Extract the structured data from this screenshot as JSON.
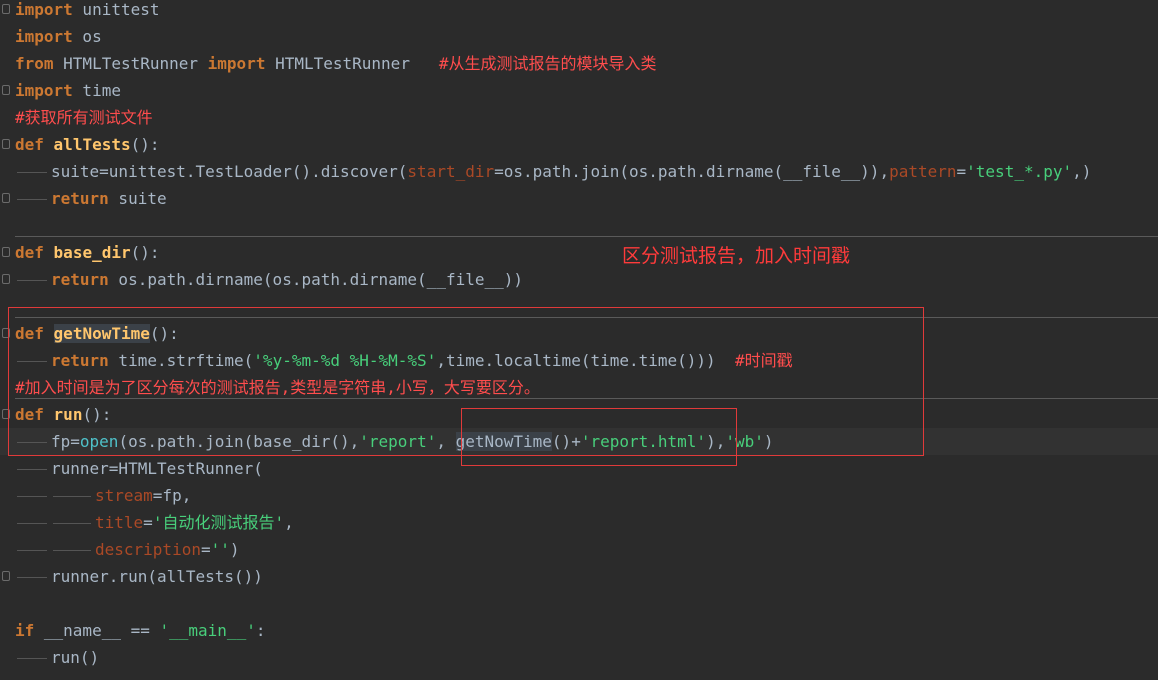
{
  "annotation": "区分测试报告，加入时间戳",
  "code": {
    "l1": [
      "import",
      " unittest"
    ],
    "l2": [
      "import",
      " os"
    ],
    "l3": [
      "from",
      " HTMLTestRunner ",
      "import",
      " HTMLTestRunner   ",
      "#从生成测试报告的模块导入类"
    ],
    "l4": [
      "import",
      " time"
    ],
    "l5": [
      "#获取所有测试文件"
    ],
    "l6": [
      "def",
      " ",
      "allTests",
      "():"
    ],
    "l7": [
      "suite=unittest.TestLoader().discover(",
      "start_dir",
      "=os.path.join(os.path.dirname(__file__)),",
      "pattern",
      "=",
      "'test_*.py'",
      ",)"
    ],
    "l8": [
      "return",
      " suite"
    ],
    "l10": [
      "def",
      " ",
      "base_dir",
      "():"
    ],
    "l11": [
      "return",
      " os.path.dirname(os.path.dirname(__file__))"
    ],
    "l13": [
      "def",
      " ",
      "getNowTime",
      "():"
    ],
    "l14": [
      "return",
      " time.strftime(",
      "'%y-%m-%d %H-%M-%S'",
      ",time.localtime(time.time()))  ",
      "#时间戳"
    ],
    "l15": [
      "#加入时间是为了区分每次的测试报告,类型是字符串,小写，大写要区分。"
    ],
    "l16": [
      "def",
      " ",
      "run",
      "():"
    ],
    "l17": [
      "fp=",
      "open",
      "(os.path.join(base_dir(),",
      "'report'",
      ", ",
      "getNowTime",
      "()+",
      "'report.html'",
      "),",
      "'wb'",
      ")"
    ],
    "l18": [
      "runner=HTMLTestRunner("
    ],
    "l19": [
      "stream",
      "=fp,"
    ],
    "l20": [
      "title",
      "=",
      "'自动化测试报告'",
      ","
    ],
    "l21": [
      "description",
      "=",
      "''",
      ")"
    ],
    "l22": [
      "runner.run(allTests())"
    ],
    "l24": [
      "if",
      " __name__ == ",
      "'__main__'",
      ":"
    ],
    "l25": [
      "run()"
    ]
  }
}
